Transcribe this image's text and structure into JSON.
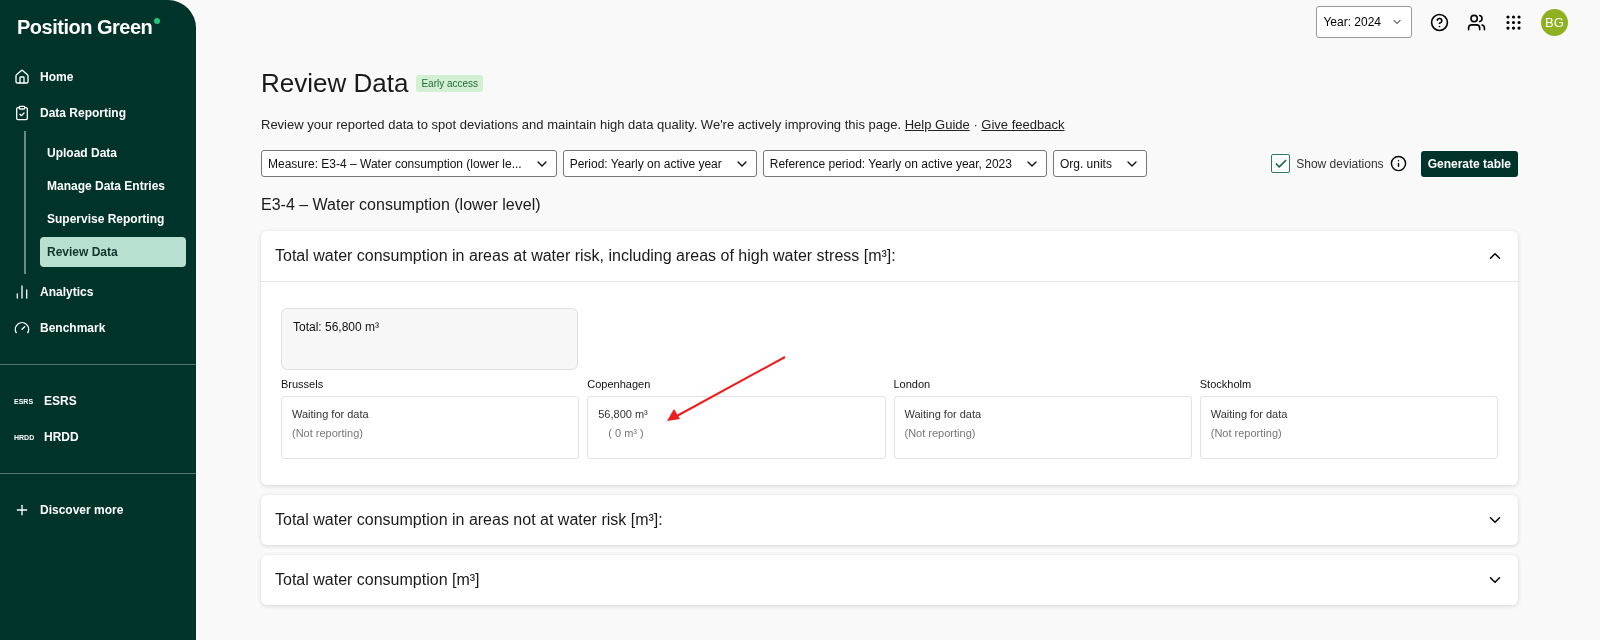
{
  "sidebar": {
    "logo": "Position Green",
    "items": [
      {
        "label": "Home",
        "kind": "home",
        "selected": false
      },
      {
        "label": "Data Reporting",
        "kind": "report",
        "selected": false,
        "children": [
          {
            "label": "Upload Data",
            "selected": false
          },
          {
            "label": "Manage Data Entries",
            "selected": false
          },
          {
            "label": "Supervise Reporting",
            "selected": false
          },
          {
            "label": "Review Data",
            "selected": true
          }
        ]
      },
      {
        "label": "Analytics",
        "kind": "analytics",
        "selected": false
      },
      {
        "label": "Benchmark",
        "kind": "gauge",
        "selected": false
      }
    ],
    "modules": [
      {
        "tag": "ESRS",
        "label": "ESRS"
      },
      {
        "tag": "HRDD",
        "label": "HRDD"
      }
    ],
    "discover": "Discover more"
  },
  "topbar": {
    "year": "Year: 2024",
    "avatar": "BG"
  },
  "page": {
    "title": "Review Data",
    "badge": "Early access",
    "description": "Review your reported data to spot deviations and maintain high data quality. We're actively improving this page.",
    "links": [
      "Help Guide",
      "Give feedback"
    ],
    "link_separator": "·",
    "filters": [
      "Measure: E3-4 – Water consumption (lower le...",
      "Period: Yearly on active year",
      "Reference period: Yearly on active year, 2023",
      "Org. units"
    ],
    "show_deviations": {
      "label": "Show deviations",
      "checked": true
    },
    "generate": "Generate table",
    "subheading": "E3-4 – Water consumption (lower level)"
  },
  "sections": [
    {
      "title": "Total water consumption in areas at water risk, including areas of high water stress [m³]:",
      "expanded": true,
      "total": "Total: 56,800 m³",
      "units": [
        {
          "name": "Brussels",
          "value": "Waiting for data",
          "reference": "(Not reporting)"
        },
        {
          "name": "Copenhagen",
          "value": "56,800 m³",
          "reference": "( 0 m³ )"
        },
        {
          "name": "London",
          "value": "Waiting for data",
          "reference": "(Not reporting)"
        },
        {
          "name": "Stockholm",
          "value": "Waiting for data",
          "reference": "(Not reporting)"
        }
      ]
    },
    {
      "title": "Total water consumption in areas not at water risk [m³]:",
      "expanded": false
    },
    {
      "title": "Total water consumption [m³]",
      "expanded": false
    }
  ]
}
